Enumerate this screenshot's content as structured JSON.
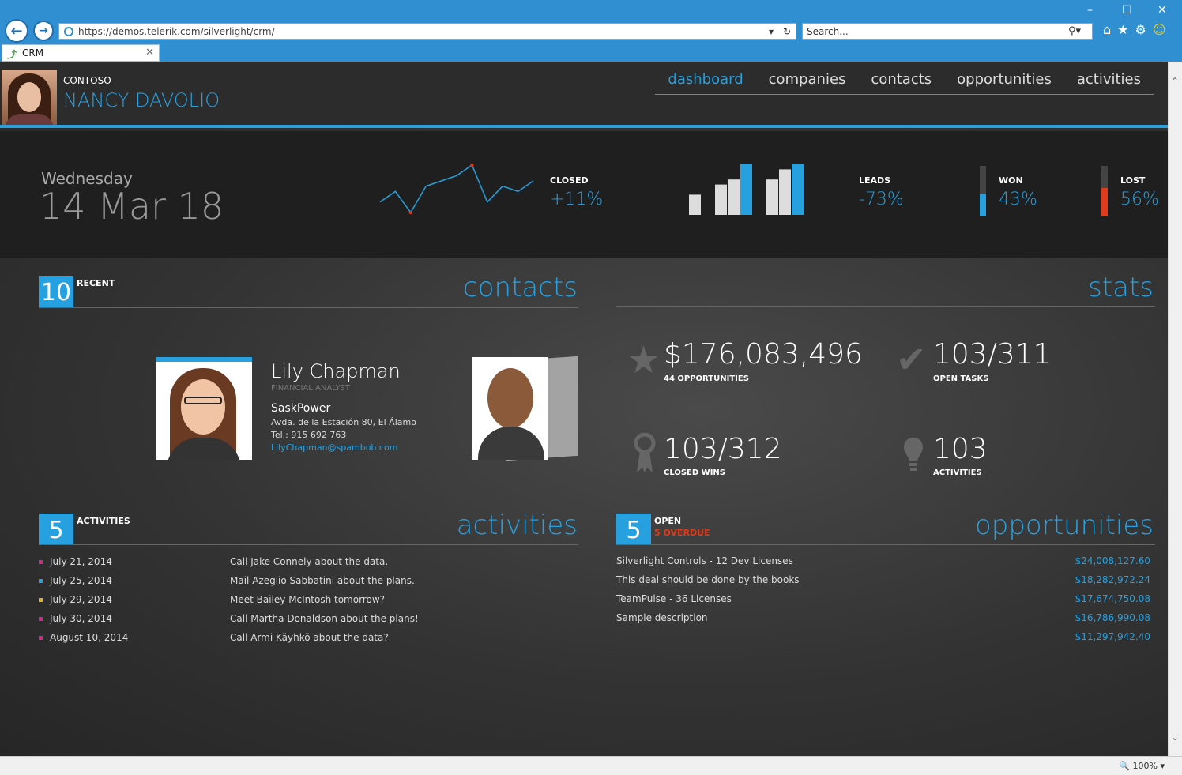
{
  "browser": {
    "url": "https://demos.telerik.com/silverlight/crm/",
    "search_placeholder": "Search...",
    "tab_label": "CRM",
    "zoom": "100%"
  },
  "user": {
    "company": "CONTOSO",
    "name": "NANCY DAVOLIO"
  },
  "nav": [
    "dashboard",
    "companies",
    "contacts",
    "opportunities",
    "activities"
  ],
  "header": {
    "day": "Wednesday",
    "date": "14 Mar 18"
  },
  "kpis": {
    "closed": {
      "label": "CLOSED",
      "value": "+11%"
    },
    "leads": {
      "label": "LEADS",
      "value": "-73%"
    },
    "won": {
      "label": "WON",
      "value": "43%",
      "level": 0.43
    },
    "lost": {
      "label": "LOST",
      "value": "56%",
      "level": 0.56
    }
  },
  "chart_data": [
    {
      "type": "line",
      "values": [
        3,
        5,
        1,
        6,
        7,
        8,
        10,
        3,
        6,
        5,
        7
      ]
    },
    {
      "type": "bar",
      "values": [
        4,
        6,
        7,
        10,
        7,
        9,
        10
      ]
    }
  ],
  "contacts": {
    "count": "10",
    "label": "RECENT",
    "title": "contacts",
    "featured": {
      "name": "Lily Chapman",
      "role": "FINANCIAL ANALYST",
      "company": "SaskPower",
      "address": "Avda. de la Estación 80, El Álamo",
      "phone": "Tel.: 915 692 763",
      "email": "LilyChapman@spambob.com"
    }
  },
  "stats": {
    "title": "stats",
    "items": [
      {
        "value": "$176,083,496",
        "label": "44 OPPORTUNITIES",
        "icon": "star-icon"
      },
      {
        "value": "103/311",
        "label": "OPEN TASKS",
        "icon": "check-icon"
      },
      {
        "value": "103/312",
        "label": "CLOSED WINS",
        "icon": "ribbon-icon"
      },
      {
        "value": "103",
        "label": "ACTIVITIES",
        "icon": "bulb-icon"
      }
    ]
  },
  "activities": {
    "count": "5",
    "label": "ACTIVITIES",
    "title": "activities",
    "items": [
      {
        "date": "July 21, 2014",
        "text": "Call Jake Connely about the data.",
        "color": "#e0208a"
      },
      {
        "date": "July 25, 2014",
        "text": "Mail Azeglio Sabbatini about the plans.",
        "color": "#27a0e0"
      },
      {
        "date": "July 29, 2014",
        "text": "Meet Bailey McIntosh tomorrow?",
        "color": "#e0b020"
      },
      {
        "date": "July 30, 2014",
        "text": "Call Martha Donaldson about the plans!",
        "color": "#e0208a"
      },
      {
        "date": "August 10, 2014",
        "text": "Call Armi Käyhkö about the data?",
        "color": "#e0208a"
      }
    ]
  },
  "opportunities": {
    "count": "5",
    "label": "OPEN",
    "overdue": "5 OVERDUE",
    "title": "opportunities",
    "items": [
      {
        "name": "Silverlight Controls - 12 Dev Licenses",
        "value": "$24,008,127.60"
      },
      {
        "name": "This deal should be done by the books",
        "value": "$18,282,972.24"
      },
      {
        "name": "TeamPulse - 36 Licenses",
        "value": "$17,674,750.08"
      },
      {
        "name": "Sample description",
        "value": "$16,786,990.08"
      },
      {
        "name": "",
        "value": "$11,297,942.40"
      }
    ]
  }
}
